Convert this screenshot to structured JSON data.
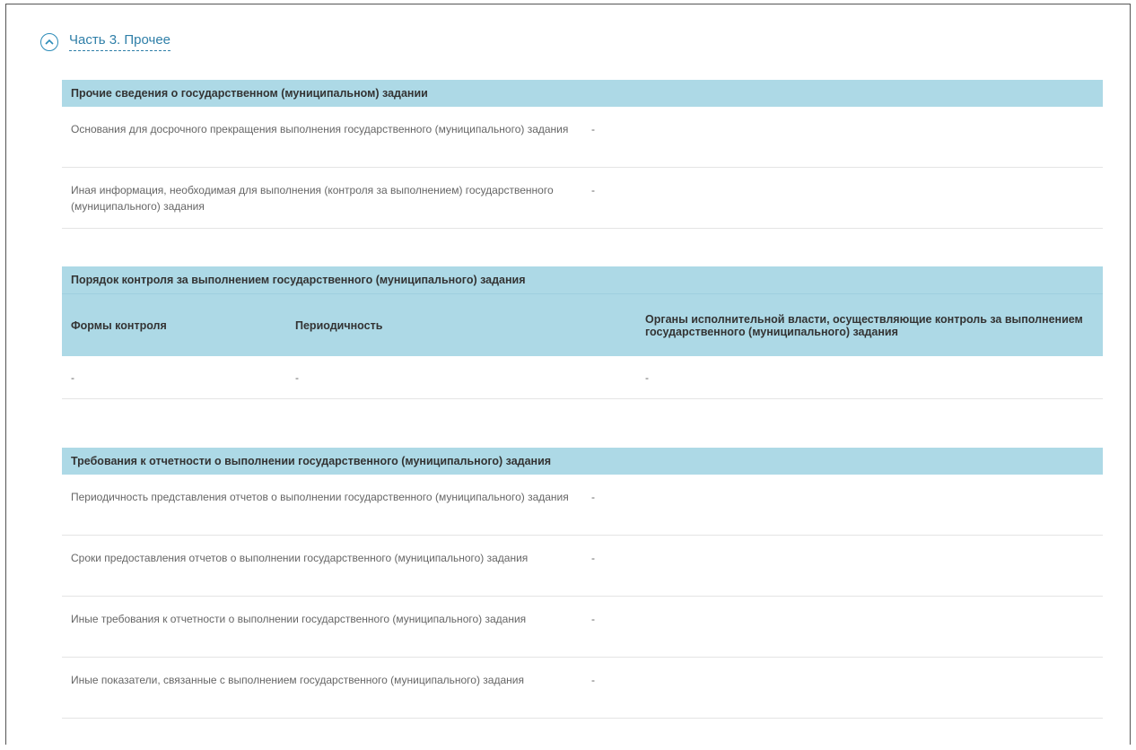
{
  "section": {
    "title": "Часть 3. Прочее",
    "icon": "chevron-up-icon"
  },
  "other_info": {
    "header": "Прочие сведения о государственном (муниципальном) задании",
    "rows": [
      {
        "label": "Основания для досрочного прекращения выполнения государственного (муниципального) задания",
        "value": "-"
      },
      {
        "label": "Иная информация, необходимая для выполнения (контроля за выполнением) государственного (муниципального) задания",
        "value": "-"
      }
    ]
  },
  "control": {
    "header": "Порядок контроля за выполнением государственного (муниципального) задания",
    "columns": [
      "Формы контроля",
      "Периодичность",
      "Органы исполнительной власти, осуществляющие контроль за выполнением государственного (муниципального) задания"
    ],
    "rows": [
      [
        "-",
        "-",
        "-"
      ]
    ]
  },
  "reporting": {
    "header": "Требования к отчетности о выполнении государственного (муниципального) задания",
    "rows": [
      {
        "label": "Периодичность представления отчетов о выполнении государственного (муниципального) задания",
        "value": "-"
      },
      {
        "label": "Сроки предоставления отчетов о выполнении государственного (муниципального) задания",
        "value": "-"
      },
      {
        "label": "Иные требования к отчетности о выполнении государственного (муниципального) задания",
        "value": "-"
      },
      {
        "label": "Иные показатели, связанные с выполнением государственного (муниципального) задания",
        "value": "-"
      }
    ]
  },
  "colors": {
    "accent": "#2f7fa8",
    "header_bg": "#add9e6"
  }
}
